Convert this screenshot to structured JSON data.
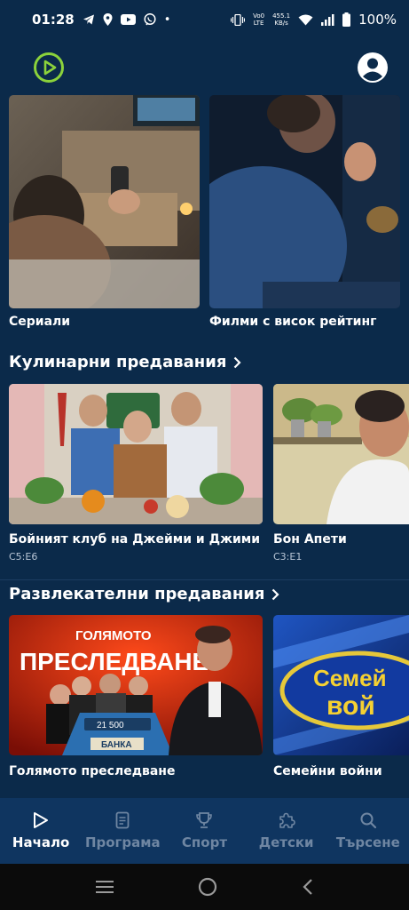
{
  "status_bar": {
    "time": "01:28",
    "dot": "•",
    "net_speed_value": "455.1",
    "net_speed_unit": "KB/s",
    "volte_top": "Vo0",
    "volte_bottom": "LTE",
    "battery": "100%",
    "icons": [
      "telegram-icon",
      "location-icon",
      "youtube-icon",
      "viber-icon",
      "vibrate-icon",
      "wifi-icon",
      "signal-icon",
      "battery-icon"
    ]
  },
  "header": {
    "logo_icon": "play-logo-icon",
    "profile_icon": "account-icon"
  },
  "rows": {
    "categories": [
      {
        "title": "Сериали"
      },
      {
        "title": "Филми с висок рейтинг"
      }
    ],
    "culinary": {
      "heading": "Кулинарни предавания",
      "items": [
        {
          "title": "Бойният клуб на Джейми и Джими",
          "episode": "C5:E6"
        },
        {
          "title": "Бон Апети",
          "episode": "C3:E1"
        }
      ]
    },
    "entertainment": {
      "heading": "Развлекателни предавания",
      "items": [
        {
          "title": "Голямото преследване",
          "logo_top": "ГОЛЯМОТО",
          "logo_main": "ПРЕСЛЕДВАНЕ",
          "score": "21 500",
          "bank": "БАНКА"
        },
        {
          "title": "Семейни войни",
          "logo_line1": "Семей",
          "logo_line2": "вой"
        }
      ]
    }
  },
  "bottom_nav": [
    {
      "label": "Начало",
      "icon": "play-icon",
      "active": true
    },
    {
      "label": "Програма",
      "icon": "document-icon",
      "active": false
    },
    {
      "label": "Спорт",
      "icon": "trophy-icon",
      "active": false
    },
    {
      "label": "Детски",
      "icon": "puzzle-icon",
      "active": false
    },
    {
      "label": "Търсене",
      "icon": "search-icon",
      "active": false
    }
  ],
  "colors": {
    "background": "#0b2a4a",
    "nav_background": "#0f3560",
    "accent_green": "#8bd23b"
  }
}
